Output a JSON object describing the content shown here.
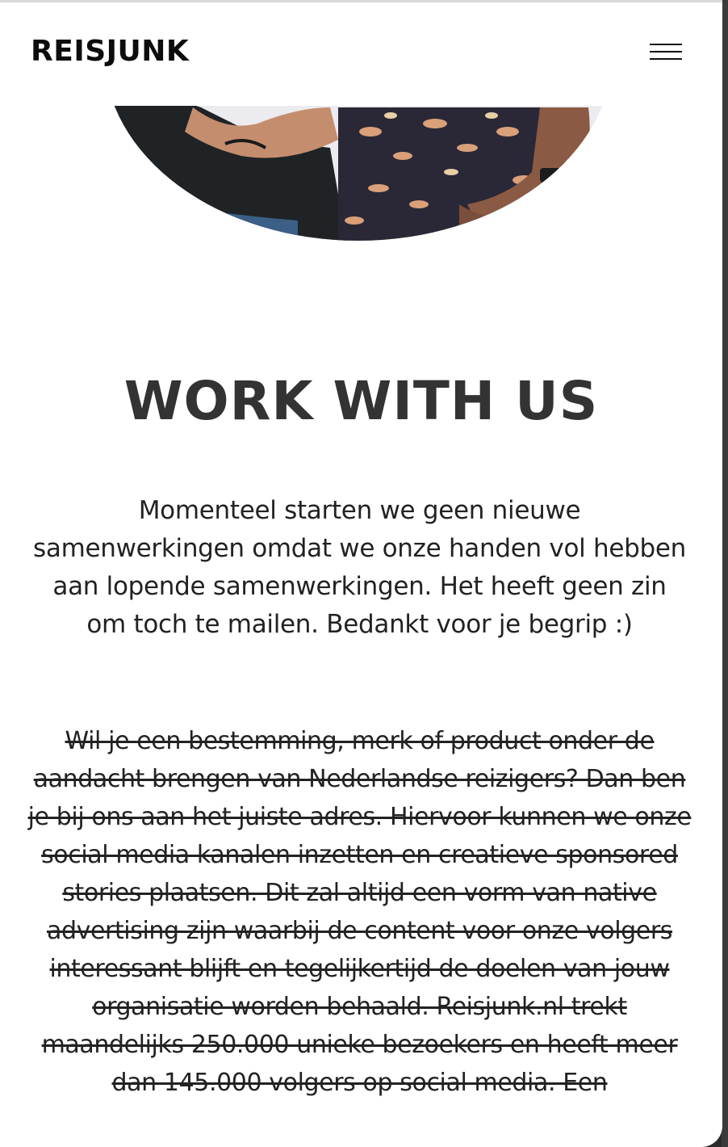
{
  "header": {
    "logo": "REISJUNK",
    "menu_icon": "hamburger-menu-icon"
  },
  "hero": {
    "image": "hero-photo-two-people-hands"
  },
  "main": {
    "title": "WORK WITH US",
    "notice": "Momenteel starten we geen nieuwe samenwerkingen omdat we onze handen vol hebben aan lopende samenwerkingen. Het heeft geen zin om toch te mailen. Bedankt voor je begrip :)",
    "struck_text": "Wil je een bestemming, merk of product onder de aandacht brengen van Nederlandse reizigers? Dan ben je bij ons aan het juiste adres. Hiervoor kunnen we onze social media kanalen inzetten en creatieve sponsored stories plaatsen. Dit zal altijd een vorm van native advertising zijn waarbij de content voor onze volgers interessant blijft en tegelijkertijd de doelen van jouw organisatie worden behaald. Reisjunk.nl trekt maandelijks 250.000 unieke bezoekers en heeft meer dan 145.000 volgers op social media. Een"
  },
  "colors": {
    "title": "#333333",
    "text": "#222222",
    "background": "#ffffff"
  }
}
